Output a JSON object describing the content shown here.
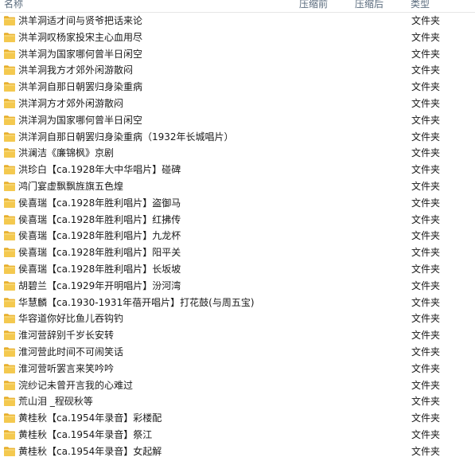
{
  "header": {
    "name": "名称",
    "compressed": "压缩前",
    "ratio": "压缩后",
    "type": "类型"
  },
  "colors": {
    "folder_body": "#f4c94f",
    "folder_tab": "#e6ad2a",
    "header_text": "#5a6b7d"
  },
  "rows": [
    {
      "name": "洪羊洞适才间与贤爷把话来论",
      "type": "文件夹",
      "icon": "folder-icon"
    },
    {
      "name": "洪羊洞叹杨家投宋主心血用尽",
      "type": "文件夹",
      "icon": "folder-icon"
    },
    {
      "name": "洪羊洞为国家哪何曾半日闲空",
      "type": "文件夹",
      "icon": "folder-icon"
    },
    {
      "name": "洪羊洞我方才郊外闲游散闷",
      "type": "文件夹",
      "icon": "folder-icon"
    },
    {
      "name": "洪羊洞自那日朝罢归身染重病",
      "type": "文件夹",
      "icon": "folder-icon"
    },
    {
      "name": "洪洋洞方才郊外闲游散闷",
      "type": "文件夹",
      "icon": "folder-icon"
    },
    {
      "name": "洪洋洞为国家哪何曾半日闲空",
      "type": "文件夹",
      "icon": "folder-icon"
    },
    {
      "name": "洪洋洞自那日朝罢归身染重病（1932年长城唱片）",
      "type": "文件夹",
      "icon": "folder-icon"
    },
    {
      "name": "洪澜洁《廉锦枫》京剧",
      "type": "文件夹",
      "icon": "folder-icon"
    },
    {
      "name": "洪珍白【ca.1928年大中华唱片】碰碑",
      "type": "文件夹",
      "icon": "folder-icon"
    },
    {
      "name": "鸿门宴虚飘飘旌旗五色煌",
      "type": "文件夹",
      "icon": "folder-icon"
    },
    {
      "name": "侯喜瑞【ca.1928年胜利唱片】盗御马",
      "type": "文件夹",
      "icon": "folder-icon"
    },
    {
      "name": "侯喜瑞【ca.1928年胜利唱片】红拂传",
      "type": "文件夹",
      "icon": "folder-icon"
    },
    {
      "name": "侯喜瑞【ca.1928年胜利唱片】九龙杯",
      "type": "文件夹",
      "icon": "folder-icon"
    },
    {
      "name": "侯喜瑞【ca.1928年胜利唱片】阳平关",
      "type": "文件夹",
      "icon": "folder-icon"
    },
    {
      "name": "侯喜瑞【ca.1928年胜利唱片】长坂坡",
      "type": "文件夹",
      "icon": "folder-icon"
    },
    {
      "name": "胡碧兰【ca.1929年开明唱片】汾河湾",
      "type": "文件夹",
      "icon": "folder-icon"
    },
    {
      "name": "华慧麟【ca.1930-1931年蓓开唱片】打花鼓(与周五宝)",
      "type": "文件夹",
      "icon": "folder-icon"
    },
    {
      "name": "华容道你好比鱼儿吞钩钓",
      "type": "文件夹",
      "icon": "folder-icon"
    },
    {
      "name": "淮河营辞别千岁长安转",
      "type": "文件夹",
      "icon": "folder-icon"
    },
    {
      "name": "淮河营此时间不可闹笑话",
      "type": "文件夹",
      "icon": "folder-icon"
    },
    {
      "name": "淮河营听罢言来笑吟吟",
      "type": "文件夹",
      "icon": "folder-icon"
    },
    {
      "name": "浣纱记未曾开言我的心难过",
      "type": "文件夹",
      "icon": "folder-icon"
    },
    {
      "name": "荒山泪 _程砚秋等",
      "type": "文件夹",
      "icon": "folder-icon"
    },
    {
      "name": "黄桂秋【ca.1954年录音】彩楼配",
      "type": "文件夹",
      "icon": "folder-icon"
    },
    {
      "name": "黄桂秋【ca.1954年录音】祭江",
      "type": "文件夹",
      "icon": "folder-icon"
    },
    {
      "name": "黄桂秋【ca.1954年录音】女起解",
      "type": "文件夹",
      "icon": "folder-icon"
    }
  ]
}
